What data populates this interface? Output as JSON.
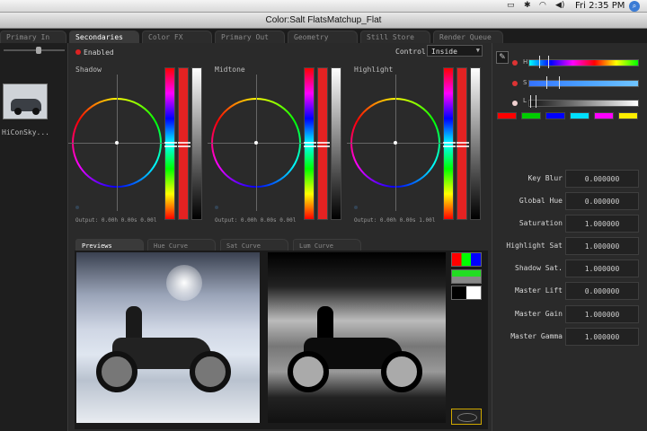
{
  "menubar": {
    "clock": "Fri 2:35 PM"
  },
  "window": {
    "title": "Color:Salt FlatsMatchup_Flat"
  },
  "tabs": [
    {
      "label": "Primary In"
    },
    {
      "label": "Secondaries"
    },
    {
      "label": "Color FX"
    },
    {
      "label": "Primary Out"
    },
    {
      "label": "Geometry"
    },
    {
      "label": "Still Store"
    },
    {
      "label": "Render Queue"
    }
  ],
  "bin": {
    "thumbnail_name": "HiConSky..."
  },
  "secondaries": {
    "enabled_label": "Enabled",
    "control_label": "Control:",
    "control_value": "Inside"
  },
  "wheels": [
    {
      "label": "Shadow",
      "output": "Output: 0.00h 0.00s 0.00l"
    },
    {
      "label": "Midtone",
      "output": "Output: 0.00h 0.00s 0.00l"
    },
    {
      "label": "Highlight",
      "output": "Output: 0.00h 0.00s 1.00l"
    }
  ],
  "lower_tabs": [
    {
      "label": "Previews"
    },
    {
      "label": "Hue Curve"
    },
    {
      "label": "Sat Curve"
    },
    {
      "label": "Lum Curve"
    }
  ],
  "hsl": {
    "h_label": "H",
    "s_label": "S",
    "l_label": "L"
  },
  "color_chips": [
    "#ff0000",
    "#00cc00",
    "#0000ff",
    "#00e0ff",
    "#ff00ff",
    "#ffee00"
  ],
  "params": [
    {
      "label": "Key Blur",
      "value": "0.000000"
    },
    {
      "label": "Global Hue",
      "value": "0.000000"
    },
    {
      "label": "Saturation",
      "value": "1.000000"
    },
    {
      "label": "Highlight Sat",
      "value": "1.000000"
    },
    {
      "label": "Shadow Sat.",
      "value": "1.000000"
    },
    {
      "label": "Master Lift",
      "value": "0.000000"
    },
    {
      "label": "Master Gain",
      "value": "1.000000"
    },
    {
      "label": "Master Gamma",
      "value": "1.000000"
    }
  ]
}
